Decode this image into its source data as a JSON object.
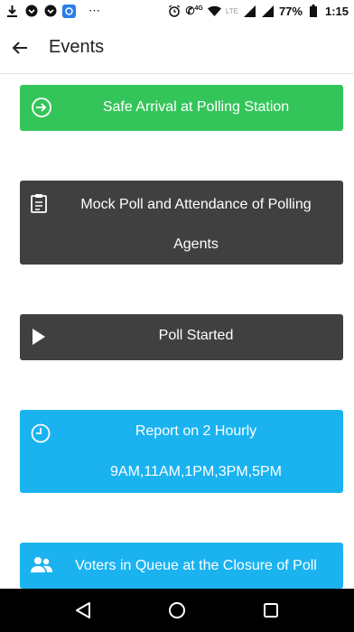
{
  "status_bar": {
    "signal_badge": "4G",
    "network": "LTE",
    "battery": "77%",
    "time": "1:15"
  },
  "app_bar": {
    "title": "Events"
  },
  "events": [
    {
      "label": "Safe Arrival at Polling Station",
      "icon": "login-arrow-icon",
      "color": "#34c55a"
    },
    {
      "label_line1": "Mock Poll and Attendance of Polling",
      "label_line2": "Agents",
      "icon": "clipboard-icon",
      "color": "#404040"
    },
    {
      "label": "Poll Started",
      "icon": "play-icon",
      "color": "#404040"
    },
    {
      "label_line1": "Report on 2 Hourly",
      "label_line2": "9AM,11AM,1PM,3PM,5PM",
      "icon": "clock-icon",
      "color": "#1ab3f0"
    },
    {
      "label": "Voters in Queue at the Closure of Poll",
      "icon": "people-icon",
      "color": "#1ab3f0"
    }
  ],
  "nav_bar": {
    "icons": [
      "back-triangle-icon",
      "home-circle-icon",
      "recents-square-icon"
    ]
  }
}
